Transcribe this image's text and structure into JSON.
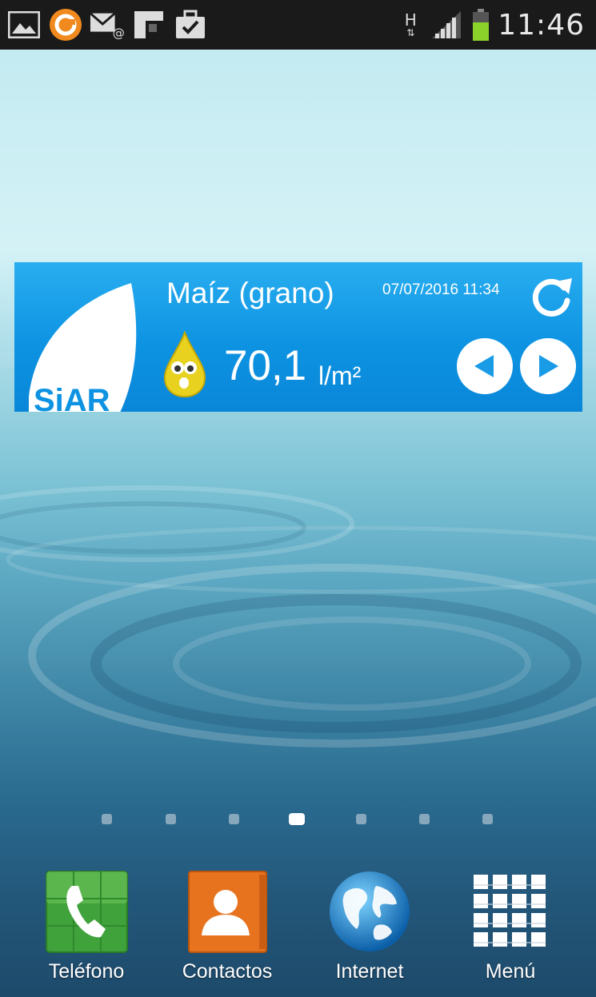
{
  "status_bar": {
    "time": "11:46",
    "network_type": "H",
    "notification_icons": [
      "gallery-icon",
      "app-circle-icon",
      "mail-icon",
      "squares-icon",
      "briefcase-icon"
    ],
    "battery_color": "#8bd22b"
  },
  "widget": {
    "logo_text": "SiAR",
    "crop": "Maíz (grano)",
    "date": "07/07/2016 11:34",
    "value": "70,1",
    "unit": "l/m²",
    "accent": "#0d93e2"
  },
  "home_pages": {
    "count": 7,
    "active_index": 3
  },
  "dock": [
    {
      "label": "Teléfono",
      "icon": "phone-icon"
    },
    {
      "label": "Contactos",
      "icon": "contacts-icon"
    },
    {
      "label": "Internet",
      "icon": "globe-icon"
    },
    {
      "label": "Menú",
      "icon": "app-grid-icon"
    }
  ]
}
